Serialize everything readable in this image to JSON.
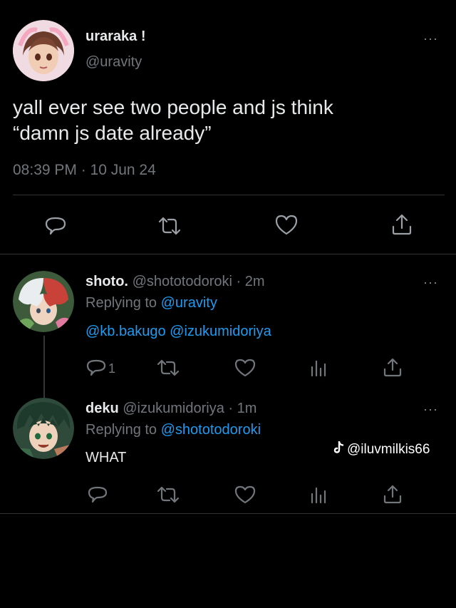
{
  "main_tweet": {
    "display_name": "uraraka !",
    "handle": "@uravity",
    "text_line1": "yall ever see two people and js think",
    "text_line2": "“damn js date already”",
    "timestamp": "08:39 PM · 10 Jun 24",
    "more": "···"
  },
  "replies": [
    {
      "display_name": "shoto.",
      "handle": "@shototodoroki",
      "age": "· 2m",
      "replying_prefix": "Replying to",
      "replying_to": "@uravity",
      "body": "@kb.bakugo @izukumidoriya",
      "reply_count": "1",
      "more": "···"
    },
    {
      "display_name": "deku",
      "handle": "@izukumidoriya",
      "age": "· 1m",
      "replying_prefix": "Replying to",
      "replying_to": "@shototodoroki",
      "body": "WHAT",
      "more": "···"
    }
  ],
  "watermark": {
    "logo": "tiktok-logo",
    "text": "@iluvmilkis66"
  },
  "icons": {
    "reply": "speech-bubble-icon",
    "retweet": "retweet-icon",
    "like": "heart-icon",
    "share": "share-icon",
    "views": "bar-chart-icon"
  },
  "colors": {
    "background": "#000000",
    "text": "#e7e9ea",
    "muted": "#71767b",
    "link": "#1d9bf0",
    "divider": "#2f3336"
  }
}
